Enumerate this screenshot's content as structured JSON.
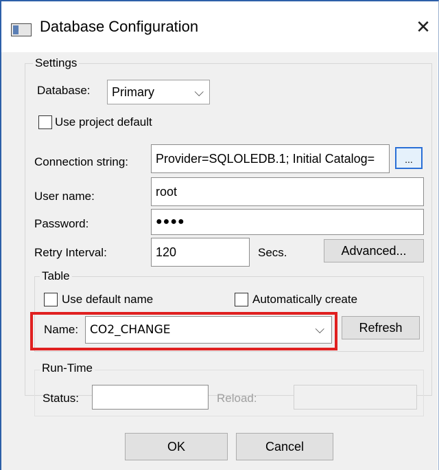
{
  "window": {
    "title": "Database Configuration",
    "close_glyph": "✕"
  },
  "settings": {
    "legend": "Settings",
    "database_label": "Database:",
    "database_value": "Primary",
    "use_project_default_label": "Use project default",
    "connection_label": "Connection string:",
    "connection_value": "Provider=SQLOLEDB.1; Initial Catalog=",
    "browse_label": "...",
    "username_label": "User name:",
    "username_value": "root",
    "password_label": "Password:",
    "password_value": "●●●●",
    "retry_label": "Retry Interval:",
    "retry_value": "120",
    "secs_label": "Secs.",
    "advanced_label": "Advanced..."
  },
  "table": {
    "legend": "Table",
    "use_default_name_label": "Use default name",
    "auto_create_label": "Automatically create",
    "name_label": "Name:",
    "name_value": "CO2_CHANGE",
    "refresh_label": "Refresh"
  },
  "runtime": {
    "legend": "Run-Time",
    "status_label": "Status:",
    "status_value": "",
    "reload_label": "Reload:",
    "reload_value": ""
  },
  "footer": {
    "ok_label": "OK",
    "cancel_label": "Cancel"
  },
  "colors": {
    "highlight": "#e02020",
    "title_border": "#2d5fa8",
    "browse_border": "#2a6fd6"
  },
  "icons": {
    "app": "window-icon",
    "close": "close-icon",
    "dropdown": "chevron-down-icon"
  }
}
